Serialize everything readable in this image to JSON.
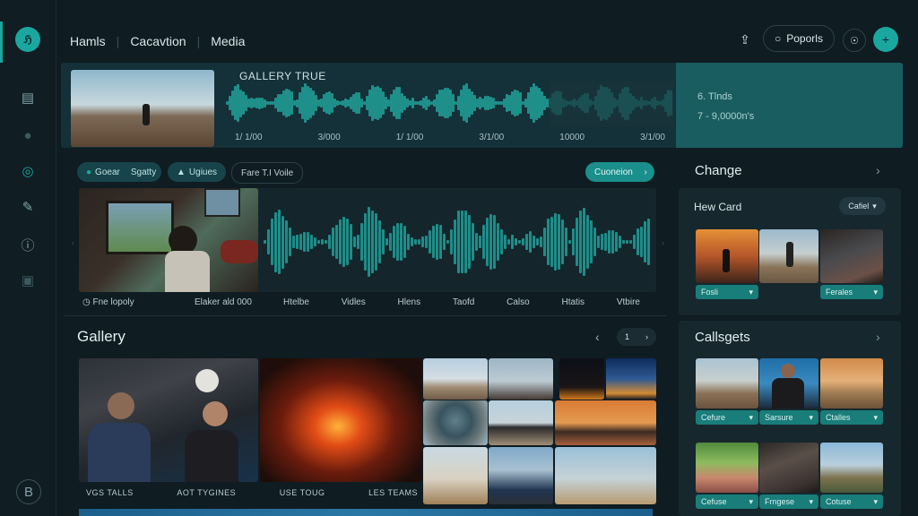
{
  "nav": {
    "items": [
      "Hamls",
      "Cacavtion",
      "Media"
    ]
  },
  "header": {
    "reports_label": "Poporls"
  },
  "hero": {
    "title": "GALLERY TRUE",
    "timeline": [
      "1/ 1/00",
      "3/000",
      "1/ 1/00",
      "3/1/00",
      "10000",
      "3/1/00"
    ],
    "stat1": "6. Tlnds",
    "stat2": "7 - 9,0000n's"
  },
  "filters": {
    "tag1": "Goear",
    "tag1b": "Sgatty",
    "tag2": "Ugiues",
    "tag3": "Fare T.I Voile",
    "action": "Cuoneion"
  },
  "audio": {
    "caption": "Fne lopoly",
    "meta": "Elaker ald 000",
    "labels": [
      "Htelbe",
      "Vidles",
      "Hlens",
      "Taofd",
      "Calso",
      "Htatis",
      "Vtbire"
    ]
  },
  "gallery": {
    "title": "Gallery",
    "page": "1",
    "captions": [
      "VGS TALLS",
      "AOT TYGINES",
      "USE TOUG",
      "LES TEAMS"
    ]
  },
  "change": {
    "title": "Change",
    "card_title": "Hew Card",
    "dropdown": "Cafiel",
    "chips": [
      "Fosli",
      "Ferales"
    ]
  },
  "callsgets": {
    "title": "Callsgets",
    "chips": [
      "Cefure",
      "Sarsure",
      "Ctalles",
      "Cefuse",
      "Frngese",
      "Cotuse"
    ]
  }
}
